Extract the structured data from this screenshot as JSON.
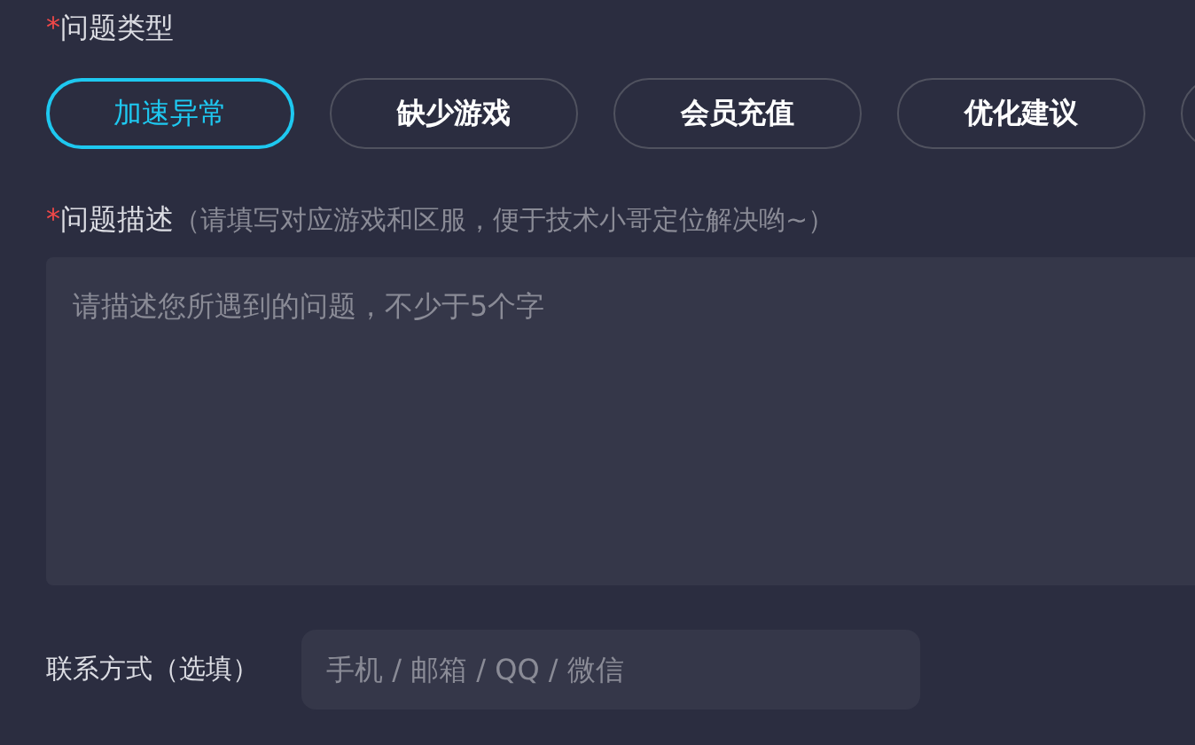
{
  "issue_type": {
    "required_mark": "*",
    "label": "问题类型",
    "options": [
      {
        "label": "加速异常",
        "selected": true
      },
      {
        "label": "缺少游戏",
        "selected": false
      },
      {
        "label": "会员充值",
        "selected": false
      },
      {
        "label": "优化建议",
        "selected": false
      }
    ]
  },
  "description": {
    "required_mark": "*",
    "label": "问题描述",
    "hint": "（请填写对应游戏和区服，便于技术小哥定位解决哟~）",
    "placeholder": "请描述您所遇到的问题，不少于5个字"
  },
  "contact": {
    "label": "联系方式（选填）",
    "placeholder": "手机 / 邮箱 / QQ / 微信"
  }
}
